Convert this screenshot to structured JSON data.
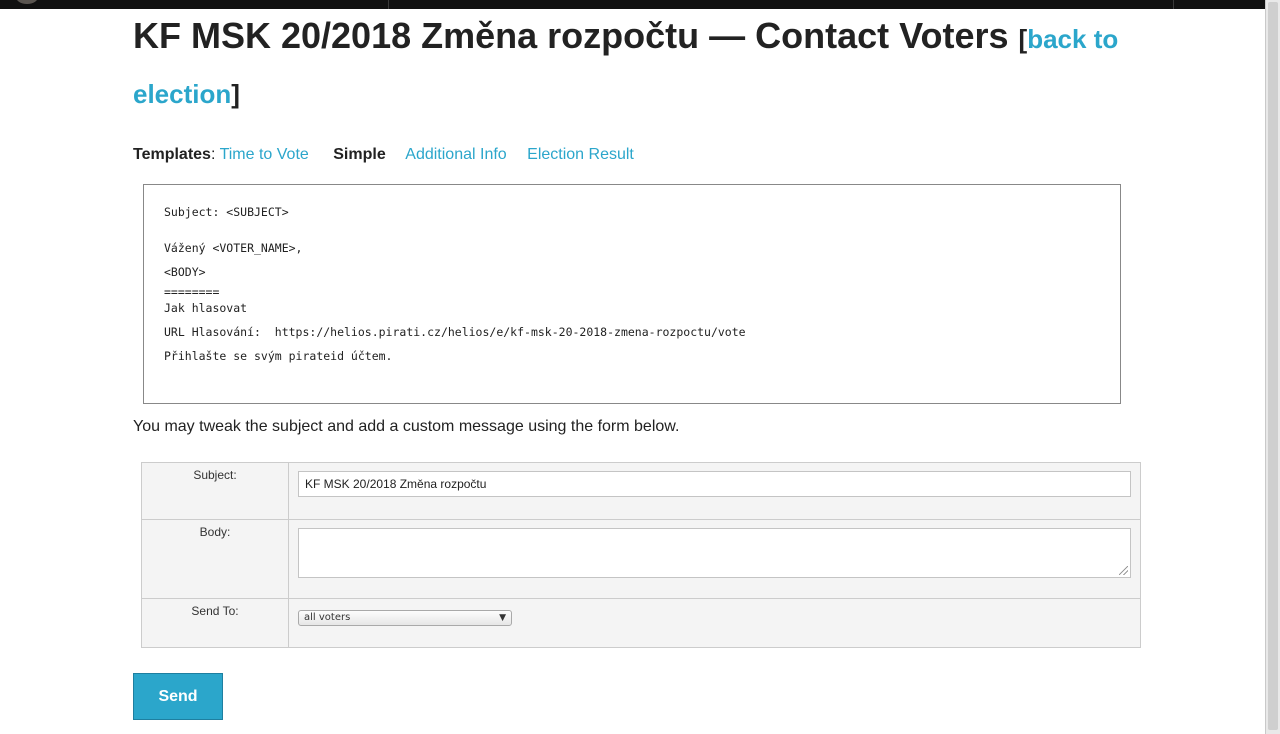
{
  "header": {
    "title": "KF MSK 20/2018 Změna rozpočtu — Contact Voters",
    "open_bracket": "[",
    "back_link": "back to election",
    "close_bracket": "]"
  },
  "templates": {
    "label": "Templates",
    "colon": ":",
    "items": [
      "Time to Vote",
      "Simple",
      "Additional Info",
      "Election Result"
    ],
    "current": "Simple"
  },
  "preview": {
    "subject_line": "Subject: <SUBJECT>",
    "greeting": "Vážený <VOTER_NAME>,",
    "body": "<BODY>",
    "separator": "========",
    "how_to": "Jak hlasovat",
    "url_line": "URL Hlasování:  https://helios.pirati.cz/helios/e/kf-msk-20-2018-zmena-rozpoctu/vote",
    "login_line": "Přihlašte se svým pirateid účtem."
  },
  "instructions": "You may tweak the subject and add a custom message using the form below.",
  "form": {
    "subject_label": "Subject:",
    "subject_value": "KF MSK 20/2018 Změna rozpočtu",
    "body_label": "Body:",
    "body_value": "",
    "send_to_label": "Send To:",
    "send_to_value": "all voters"
  },
  "send_button": "Send",
  "colors": {
    "accent": "#2ba6cb",
    "topbar": "#111111"
  }
}
